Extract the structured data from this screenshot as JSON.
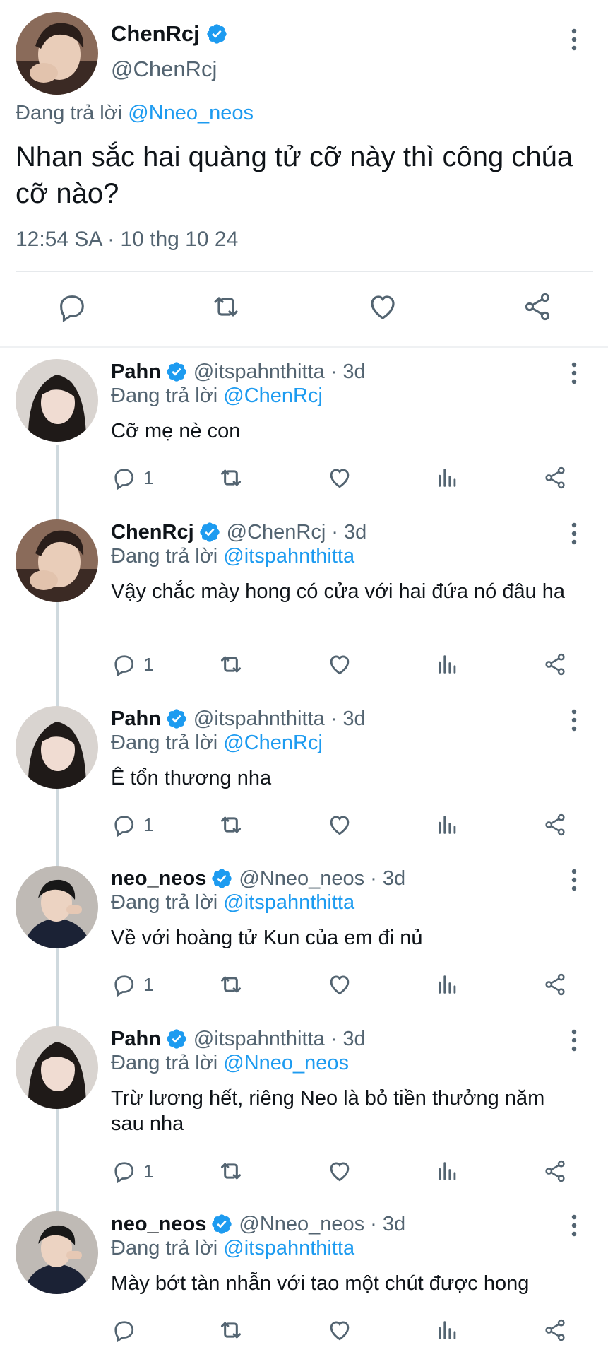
{
  "main_tweet": {
    "author": "ChenRcj",
    "handle": "@ChenRcj",
    "replying_prefix": "Đang trả lời",
    "replying_to": "@Nneo_neos",
    "text": "Nhan sắc hai quàng tử cỡ này thì công chúa cỡ nào?",
    "timestamp": "12:54 SA · 10 thg 10 24"
  },
  "replies": [
    {
      "author": "Pahn",
      "handle": "@itspahnthitta",
      "time": "3d",
      "replying_prefix": "Đang trả lời",
      "replying_to": "@ChenRcj",
      "text": "Cỡ mẹ nè con",
      "reply_count": "1"
    },
    {
      "author": "ChenRcj",
      "handle": "@ChenRcj",
      "time": "3d",
      "replying_prefix": "Đang trả lời",
      "replying_to": "@itspahnthitta",
      "text": "Vậy chắc mày hong có cửa với hai đứa nó đâu ha",
      "reply_count": "1"
    },
    {
      "author": "Pahn",
      "handle": "@itspahnthitta",
      "time": "3d",
      "replying_prefix": "Đang trả lời",
      "replying_to": "@ChenRcj",
      "text": "Ê tổn thương nha",
      "reply_count": "1"
    },
    {
      "author": "neo_neos",
      "handle": "@Nneo_neos",
      "time": "3d",
      "replying_prefix": "Đang trả lời",
      "replying_to": "@itspahnthitta",
      "text": "Về với hoàng tử Kun của em đi nủ",
      "reply_count": "1"
    },
    {
      "author": "Pahn",
      "handle": "@itspahnthitta",
      "time": "3d",
      "replying_prefix": "Đang trả lời",
      "replying_to": "@Nneo_neos",
      "text": "Trừ lương hết, riêng Neo là bỏ tiền thưởng năm sau nha",
      "reply_count": "1"
    },
    {
      "author": "neo_neos",
      "handle": "@Nneo_neos",
      "time": "3d",
      "replying_prefix": "Đang trả lời",
      "replying_to": "@itspahnthitta",
      "text": "Mày bớt tàn nhẫn với tao một chút được hong",
      "reply_count": ""
    }
  ],
  "icons": {
    "reply": "speech-bubble-icon",
    "retweet": "retweet-icon",
    "like": "heart-icon",
    "views": "bar-chart-icon",
    "share": "share-icon",
    "more": "vertical-ellipsis-icon",
    "verified": "verified-badge-icon"
  },
  "colors": {
    "link": "#1d9bf0",
    "secondary_text": "#536471",
    "primary_text": "#0f1419",
    "verified": "#1d9bf0"
  }
}
